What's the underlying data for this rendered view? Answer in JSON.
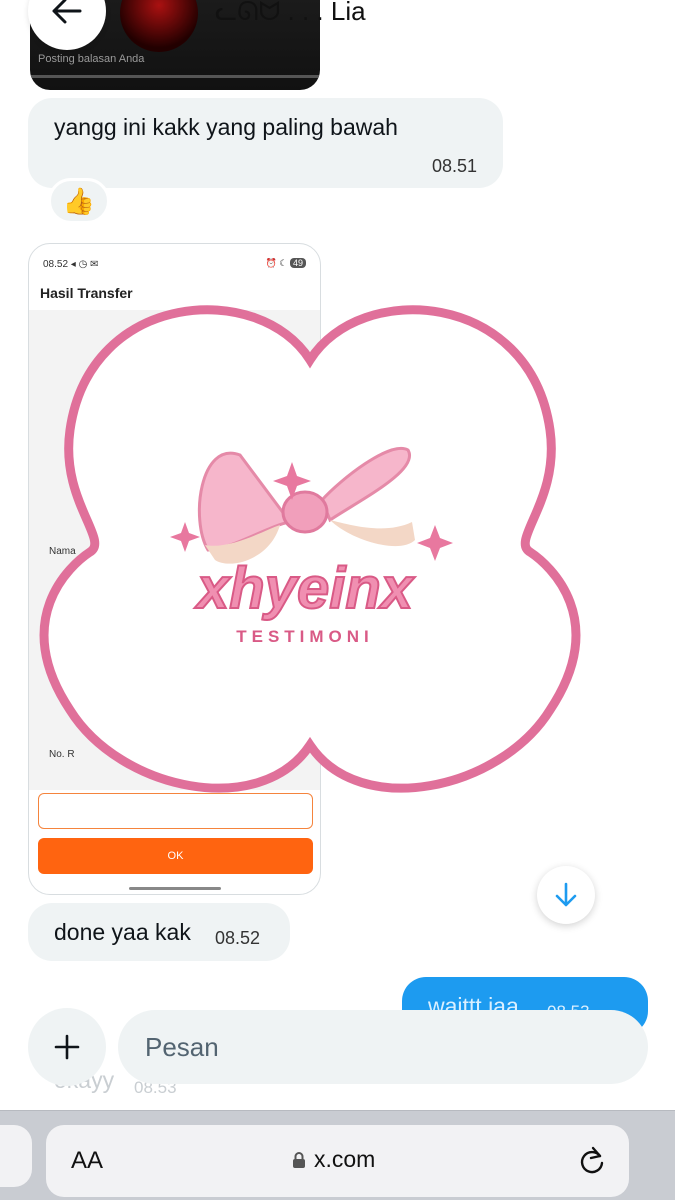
{
  "header": {
    "contact_name": "ᓚᘏᗢ . . . Lia",
    "quoted_subtitle": "Posting balasan Anda"
  },
  "messages": {
    "m1": {
      "text": "yangg ini kakk yang paling bawah",
      "time": "08.51",
      "reaction": "👍"
    },
    "screenshot": {
      "status_time": "08.52",
      "battery": "49",
      "title": "Hasil Transfer",
      "label_nama": "Nama",
      "label_no": "No. R",
      "ok_label": "OK"
    },
    "m2": {
      "text": "done yaa kak",
      "time": "08.52"
    },
    "m3": {
      "text": "waittt jaa",
      "time": "08.53"
    },
    "m4": {
      "text": "okayy",
      "time": "08.53"
    }
  },
  "watermark": {
    "brand": "xhyeinx",
    "tagline": "TESTIMONI"
  },
  "composer": {
    "placeholder": "Pesan"
  },
  "browser": {
    "aa_label": "AA",
    "url": "x.com"
  },
  "colors": {
    "accent": "#1d9bf0",
    "bubble_in": "#eff3f4",
    "watermark_pink": "#e0709a",
    "ok_orange": "#ff6410"
  }
}
